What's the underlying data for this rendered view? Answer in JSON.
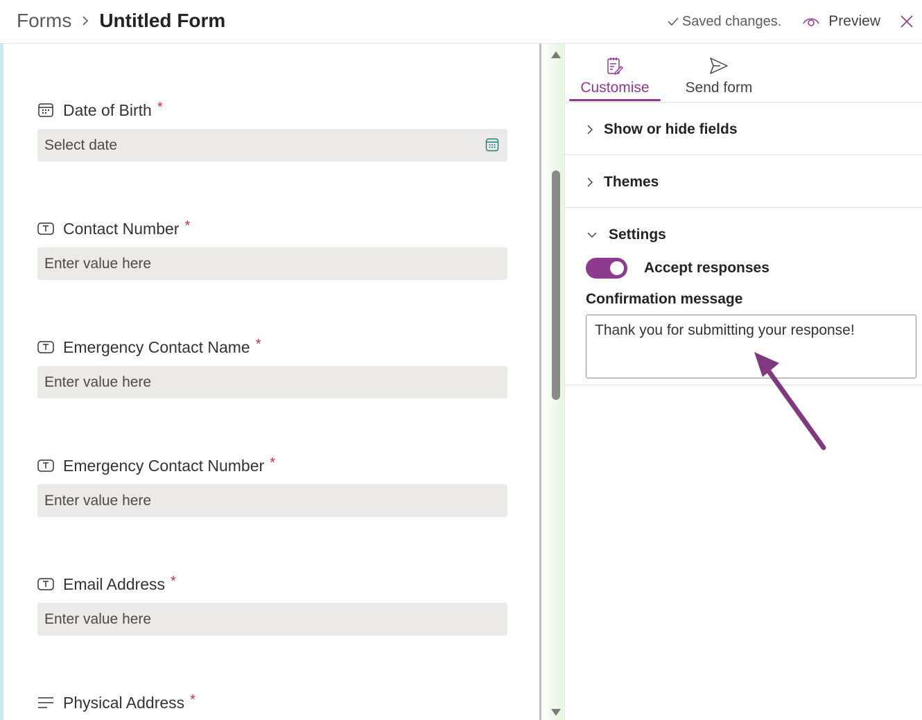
{
  "header": {
    "breadcrumb_root": "Forms",
    "breadcrumb_current": "Untitled Form",
    "saved_status": "Saved changes.",
    "preview_label": "Preview"
  },
  "form": {
    "fields": [
      {
        "label": "Date of Birth",
        "required": "*",
        "placeholder": "Select date",
        "icon": "calendar-icon"
      },
      {
        "label": "Contact Number",
        "required": "*",
        "placeholder": "Enter value here",
        "icon": "text-field-icon"
      },
      {
        "label": "Emergency Contact Name",
        "required": "*",
        "placeholder": "Enter value here",
        "icon": "text-field-icon"
      },
      {
        "label": "Emergency Contact Number",
        "required": "*",
        "placeholder": "Enter value here",
        "icon": "text-field-icon"
      },
      {
        "label": "Email Address",
        "required": "*",
        "placeholder": "Enter value here",
        "icon": "text-field-icon"
      },
      {
        "label": "Physical Address",
        "required": "*",
        "icon": "multiline-text-icon"
      }
    ]
  },
  "panel": {
    "tabs": [
      {
        "label": "Customise",
        "icon": "customise-icon",
        "active": true
      },
      {
        "label": "Send form",
        "icon": "send-icon",
        "active": false
      }
    ],
    "sections": {
      "show_hide": "Show or hide fields",
      "themes": "Themes",
      "settings": "Settings"
    },
    "accept_responses_label": "Accept responses",
    "accept_responses_on": true,
    "confirmation_label": "Confirmation message",
    "confirmation_value": "Thank you for submitting your response!"
  },
  "colors": {
    "accent": "#8e3a8e",
    "required": "#c4314b",
    "input_bg": "#ebeae9"
  }
}
